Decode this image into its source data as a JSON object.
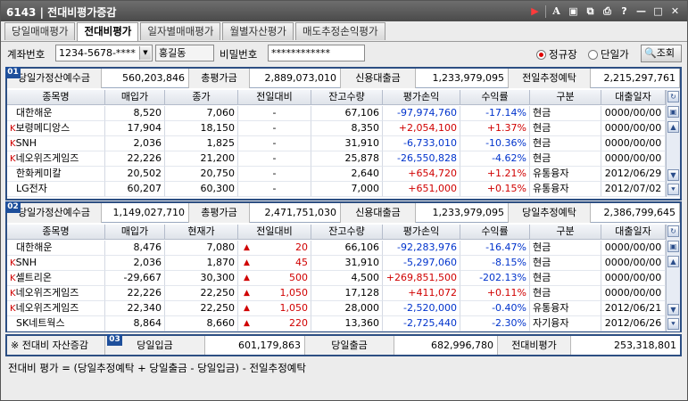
{
  "window": {
    "code": "6143",
    "title": "전대비평가증감"
  },
  "tabs": [
    "당일매매평가",
    "전대비평가",
    "일자별매매평가",
    "월별자산평가",
    "매도추정손익평가"
  ],
  "active_tab": 1,
  "controls": {
    "account_label": "계좌번호",
    "account_value": "1234-5678-****",
    "name_value": "홍길동",
    "password_label": "비밀번호",
    "password_value": "************",
    "radio1": "정규장",
    "radio2": "단일가",
    "query_button": "조회"
  },
  "section1": {
    "badge": "01",
    "summary": {
      "l1": "당일가정산예수금",
      "v1": "560,203,846",
      "l2": "총평가금",
      "v2": "2,889,073,010",
      "l3": "신용대출금",
      "v3": "1,233,979,095",
      "l4": "전일추정예탁",
      "v4": "2,215,297,761"
    },
    "headers": [
      "종목명",
      "매입가",
      "종가",
      "전일대비",
      "잔고수량",
      "평가손익",
      "수익률",
      "구분",
      "대출일자"
    ],
    "rows": [
      {
        "k": "",
        "name": "대한해운",
        "buy": "8,520",
        "price": "7,060",
        "chg": "-",
        "qty": "67,106",
        "pl": "-97,974,760",
        "rate": "-17.14%",
        "type": "현금",
        "date": "0000/00/00",
        "dir": "dn"
      },
      {
        "k": "K",
        "name": "보령메디앙스",
        "buy": "17,904",
        "price": "18,150",
        "chg": "-",
        "qty": "8,350",
        "pl": "+2,054,100",
        "rate": "+1.37%",
        "type": "현금",
        "date": "0000/00/00",
        "dir": "up"
      },
      {
        "k": "K",
        "name": "SNH",
        "buy": "2,036",
        "price": "1,825",
        "chg": "-",
        "qty": "31,910",
        "pl": "-6,733,010",
        "rate": "-10.36%",
        "type": "현금",
        "date": "0000/00/00",
        "dir": "dn"
      },
      {
        "k": "K",
        "name": "네오위즈게임즈",
        "buy": "22,226",
        "price": "21,200",
        "chg": "-",
        "qty": "25,878",
        "pl": "-26,550,828",
        "rate": "-4.62%",
        "type": "현금",
        "date": "0000/00/00",
        "dir": "dn"
      },
      {
        "k": "",
        "name": "한화케미칼",
        "buy": "20,502",
        "price": "20,750",
        "chg": "-",
        "qty": "2,640",
        "pl": "+654,720",
        "rate": "+1.21%",
        "type": "유통융자",
        "date": "2012/06/29",
        "dir": "up"
      },
      {
        "k": "",
        "name": "LG전자",
        "buy": "60,207",
        "price": "60,300",
        "chg": "-",
        "qty": "7,000",
        "pl": "+651,000",
        "rate": "+0.15%",
        "type": "유통융자",
        "date": "2012/07/02",
        "dir": "up"
      }
    ]
  },
  "section2": {
    "badge": "02",
    "summary": {
      "l1": "당일가정산예수금",
      "v1": "1,149,027,710",
      "l2": "총평가금",
      "v2": "2,471,751,030",
      "l3": "신용대출금",
      "v3": "1,233,979,095",
      "l4": "당일추정예탁",
      "v4": "2,386,799,645"
    },
    "headers": [
      "종목명",
      "매입가",
      "현재가",
      "전일대비",
      "잔고수량",
      "평가손익",
      "수익률",
      "구분",
      "대출일자"
    ],
    "rows": [
      {
        "k": "",
        "name": "대한해운",
        "buy": "8,476",
        "price": "7,080",
        "chg": "20",
        "qty": "66,106",
        "pl": "-92,283,976",
        "rate": "-16.47%",
        "type": "현금",
        "date": "0000/00/00",
        "dir": "dn"
      },
      {
        "k": "K",
        "name": "SNH",
        "buy": "2,036",
        "price": "1,870",
        "chg": "45",
        "qty": "31,910",
        "pl": "-5,297,060",
        "rate": "-8.15%",
        "type": "현금",
        "date": "0000/00/00",
        "dir": "dn"
      },
      {
        "k": "K",
        "name": "셀트리온",
        "buy": "-29,667",
        "price": "30,300",
        "chg": "500",
        "qty": "4,500",
        "pl": "+269,851,500",
        "rate": "-202.13%",
        "type": "현금",
        "date": "0000/00/00",
        "dir": "mix"
      },
      {
        "k": "K",
        "name": "네오위즈게임즈",
        "buy": "22,226",
        "price": "22,250",
        "chg": "1,050",
        "qty": "17,128",
        "pl": "+411,072",
        "rate": "+0.11%",
        "type": "현금",
        "date": "0000/00/00",
        "dir": "up"
      },
      {
        "k": "K",
        "name": "네오위즈게임즈",
        "buy": "22,340",
        "price": "22,250",
        "chg": "1,050",
        "qty": "28,000",
        "pl": "-2,520,000",
        "rate": "-0.40%",
        "type": "유통융자",
        "date": "2012/06/21",
        "dir": "dn"
      },
      {
        "k": "",
        "name": "SK네트웍스",
        "buy": "8,864",
        "price": "8,660",
        "chg": "220",
        "qty": "13,360",
        "pl": "-2,725,440",
        "rate": "-2.30%",
        "type": "자기융자",
        "date": "2012/06/26",
        "dir": "dn"
      }
    ]
  },
  "section3": {
    "badge": "03",
    "title": "※ 전대비 자산증감",
    "l1": "당일입금",
    "v1": "601,179,863",
    "l2": "당일출금",
    "v2": "682,996,780",
    "l3": "전대비평가",
    "v3": "253,318,801"
  },
  "footer": "전대비 평가 = (당일추정예탁 + 당일출금 - 당일입금) - 전일추정예탁"
}
